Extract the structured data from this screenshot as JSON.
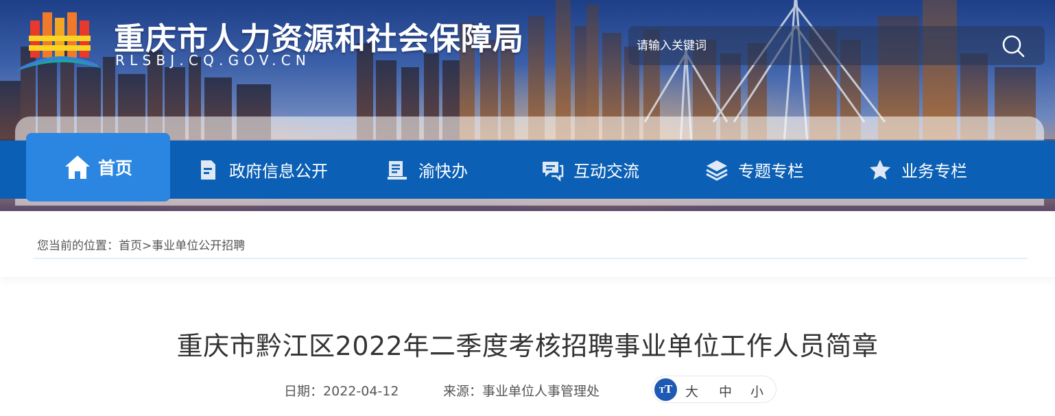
{
  "header": {
    "site_title": "重庆市人力资源和社会保障局",
    "site_domain": "RLSBJ.CQ.GOV.CN",
    "search_placeholder": "请输入关键词",
    "logo_icon": "logo-emblem",
    "search_icon": "search-icon"
  },
  "nav": {
    "items": [
      {
        "label": "首页",
        "icon": "home-icon",
        "active": true
      },
      {
        "label": "政府信息公开",
        "icon": "document-icon"
      },
      {
        "label": "渝快办",
        "icon": "book-icon"
      },
      {
        "label": "互动交流",
        "icon": "chat-icon"
      },
      {
        "label": "专题专栏",
        "icon": "layers-icon"
      },
      {
        "label": "业务专栏",
        "icon": "star-icon"
      }
    ]
  },
  "breadcrumb": {
    "prefix": "您当前的位置：",
    "home": "首页",
    "separator": ">",
    "current": "事业单位公开招聘"
  },
  "article": {
    "title": "重庆市黔江区2022年二季度考核招聘事业单位工作人员简章",
    "date_label": "日期：",
    "date": "2022-04-12",
    "source_label": "来源：",
    "source": "事业单位人事管理处",
    "font_size": {
      "badge": "T",
      "large": "大",
      "medium": "中",
      "small": "小"
    }
  },
  "colors": {
    "nav_bg": "#0b5fb4",
    "nav_active": "#2a86e0",
    "font_badge": "#1e5ab4"
  }
}
